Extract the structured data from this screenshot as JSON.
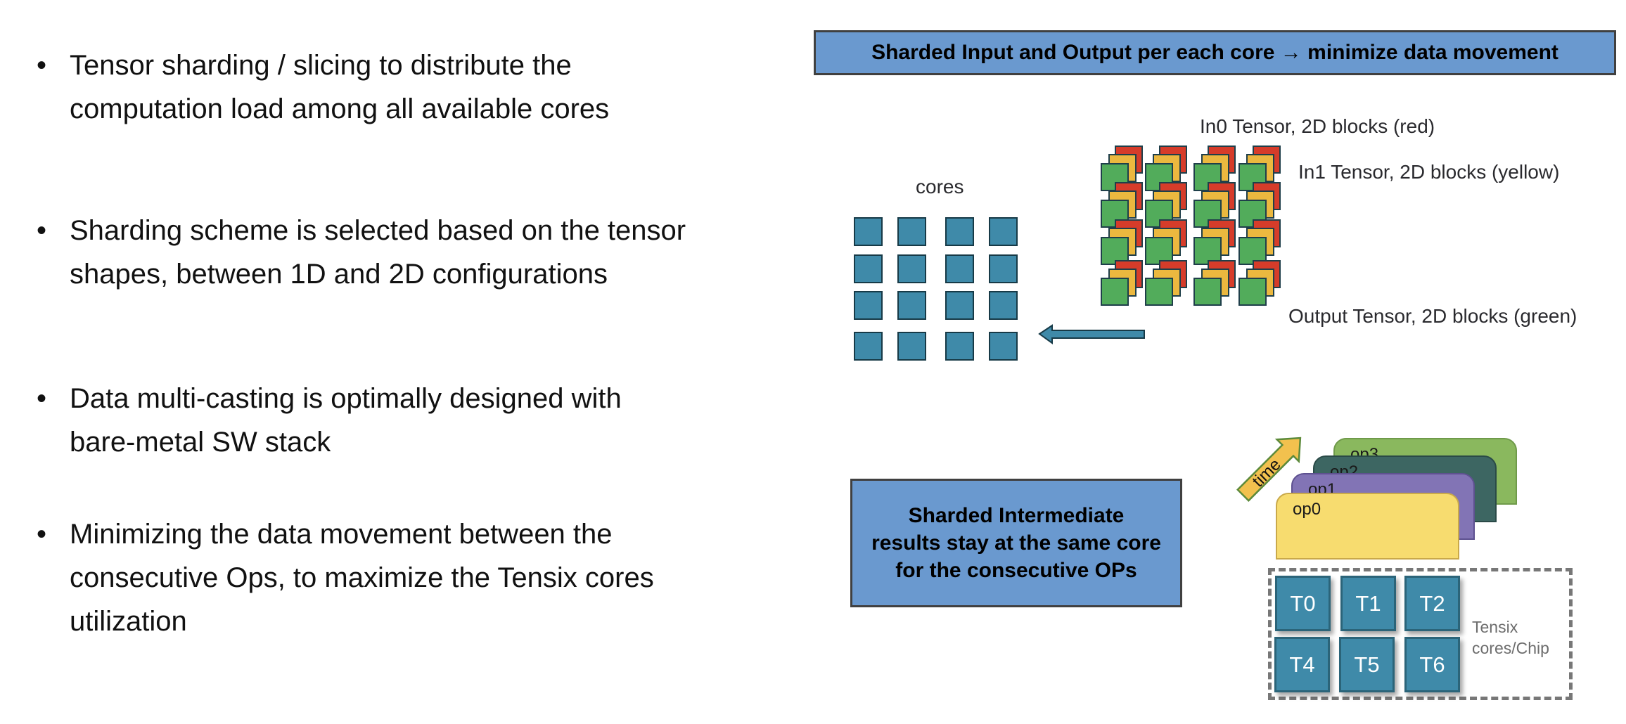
{
  "bullets": [
    {
      "symbol": "•",
      "text": "Tensor sharding / slicing to distribute the\ncomputation load among all available cores"
    },
    {
      "symbol": "•",
      "text": "Sharding scheme is selected based on the tensor\nshapes, between 1D and 2D configurations"
    },
    {
      "symbol": "•",
      "text": "Data multi-casting is optimally designed with\nbare-metal SW stack"
    },
    {
      "symbol": "•",
      "text": "Minimizing the data movement between the\nconsecutive Ops, to maximize the Tensix cores\nutilization"
    }
  ],
  "top_diagram": {
    "title": "Sharded Input and Output per each core → minimize data movement",
    "cores_label": "cores",
    "cores_grid": {
      "rows": 4,
      "cols": 4
    },
    "tensor_grid": {
      "rows": 4,
      "cols": 4
    },
    "in0_label": "In0 Tensor, 2D blocks (red)",
    "in1_label": "In1 Tensor, 2D blocks (yellow)",
    "output_label": "Output Tensor, 2D blocks (green)",
    "arrow_direction": "left",
    "colors": {
      "core": "#3f8aa9",
      "in0": "#d63c2a",
      "in1": "#ebb83f",
      "output": "#52ac5b",
      "title_bg": "#6a99cf"
    }
  },
  "bottom_diagram": {
    "note": "Sharded Intermediate\nresults stay at the same core\nfor the consecutive OPs",
    "time_label": "time",
    "ops": [
      {
        "label": "op3",
        "color": "#8ab85e",
        "border": "#6f9a4a"
      },
      {
        "label": "op2",
        "color": "#3d6662",
        "border": "#2a4a47"
      },
      {
        "label": "op1",
        "color": "#8274b5",
        "border": "#5e5190"
      },
      {
        "label": "op0",
        "color": "#f7dc6f",
        "border": "#c9a94a"
      }
    ],
    "tensix_cores": [
      "T0",
      "T1",
      "T2",
      "T4",
      "T5",
      "T6"
    ],
    "chip_label": "Tensix\ncores/Chip"
  }
}
